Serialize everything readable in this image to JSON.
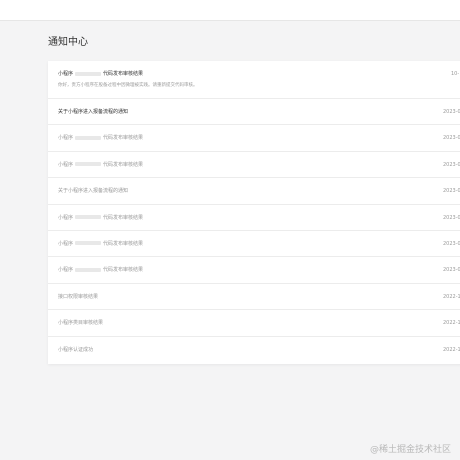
{
  "header": {
    "title": "通知中心"
  },
  "notifications": [
    {
      "title_prefix": "小程序",
      "title_suffix": "代码发布审核结果",
      "description": "你好，贵方小程序在股备过程中因微理被实践。请重新提交代码审核。",
      "date": "10-"
    },
    {
      "title": "关于小程序进入报备流程的通知",
      "date": "2023-0"
    },
    {
      "title_prefix": "小程序",
      "title_suffix": "代码发布审核结果",
      "date": "2023-0"
    },
    {
      "title_prefix": "小程序",
      "title_suffix": "代码发布审核结果",
      "date": "2023-0"
    },
    {
      "title": "关于小程序进入报备流程的通知",
      "date": "2023-0"
    },
    {
      "title_prefix": "小程序",
      "title_suffix": "代码发布审核结果",
      "date": "2023-0"
    },
    {
      "title_prefix": "小程序",
      "title_suffix": "代码发布审核结果",
      "date": "2023-0"
    },
    {
      "title_prefix": "小程序",
      "title_suffix": "代码发布审核结果",
      "date": "2023-0"
    },
    {
      "title": "接口权限审核结果",
      "date": "2022-1"
    },
    {
      "title": "小程序类目审核结果",
      "date": "2022-1"
    },
    {
      "title": "小程序认证成功",
      "date": "2022-1"
    }
  ],
  "watermark": "@稀土掘金技术社区",
  "colors": {
    "background": "#f4f4f5",
    "panel": "#ffffff",
    "text_primary": "#333333",
    "text_secondary": "#9a9a9a"
  }
}
